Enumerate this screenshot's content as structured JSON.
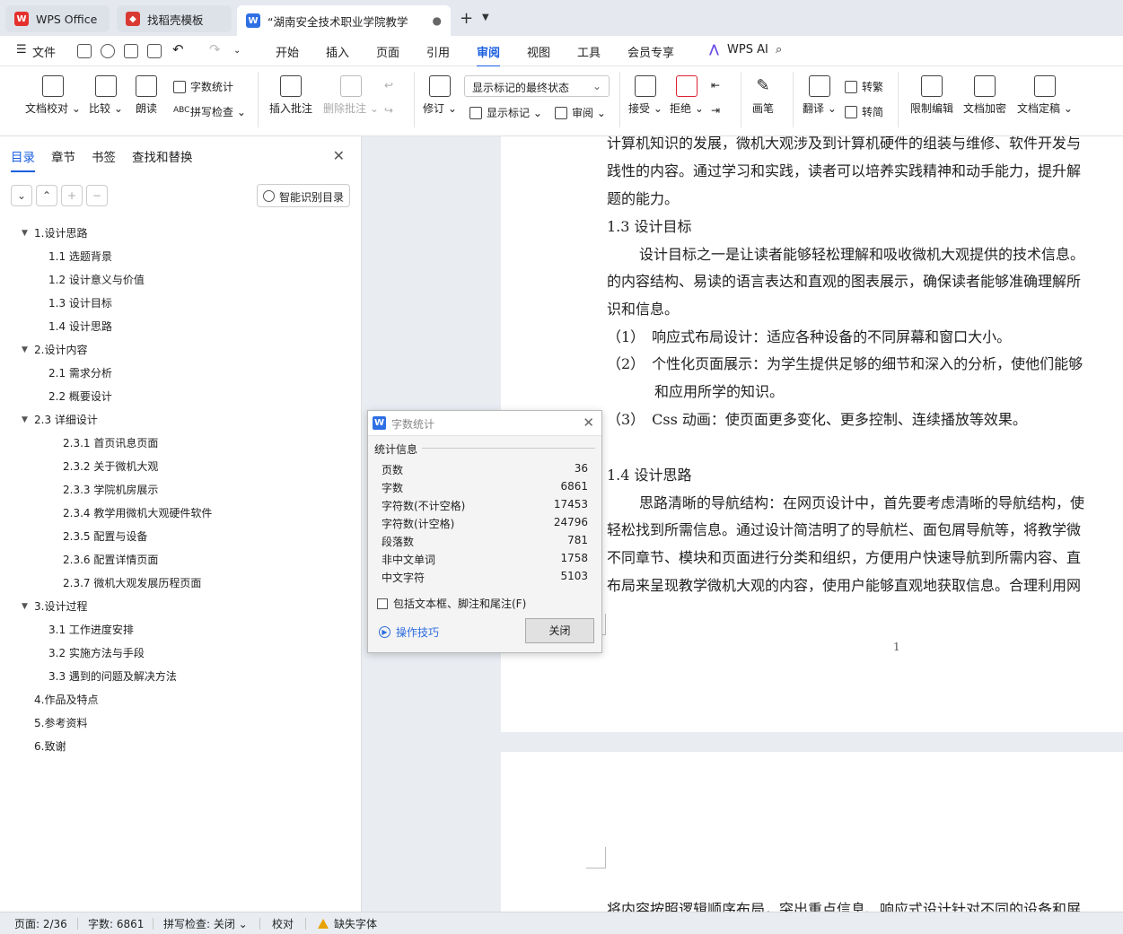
{
  "tabs": [
    {
      "label": "WPS Office",
      "color": "#e5312d"
    },
    {
      "label": "找稻壳模板",
      "color": "#d83a32"
    },
    {
      "label": "“湖南安全技术职业学院教学",
      "color": "#2f6fe4"
    }
  ],
  "menubar": {
    "file": "文件",
    "items": [
      "开始",
      "插入",
      "页面",
      "引用",
      "审阅",
      "视图",
      "工具",
      "会员专享"
    ],
    "active": "审阅",
    "wps_ai": "WPS AI"
  },
  "ribbon": {
    "doc_proofread": "文档校对",
    "compare": "比较",
    "read_aloud": "朗读",
    "word_count": "字数统计",
    "spell_check": "拼写检查",
    "insert_comment": "插入批注",
    "delete_comment": "删除批注",
    "revise": "修订",
    "display_select": "显示标记的最终状态",
    "show_markup": "显示标记",
    "review": "审阅",
    "accept": "接受",
    "reject": "拒绝",
    "pen": "画笔",
    "translate": "翻译",
    "to_traditional": "转繁",
    "to_simplified": "转简",
    "restrict_edit": "限制编辑",
    "encrypt": "文档加密",
    "finalize": "文档定稿"
  },
  "nav": {
    "tabs": [
      "目录",
      "章节",
      "书签",
      "查找和替换"
    ],
    "smart_toc": "智能识别目录",
    "toc": [
      {
        "label": "1.设计思路",
        "level": 1,
        "expanded": true
      },
      {
        "label": "1.1 选题背景",
        "level": 2
      },
      {
        "label": "1.2 设计意义与价值",
        "level": 2
      },
      {
        "label": "1.3 设计目标",
        "level": 2
      },
      {
        "label": "1.4 设计思路",
        "level": 2
      },
      {
        "label": "2.设计内容",
        "level": 1,
        "expanded": true
      },
      {
        "label": "2.1 需求分析",
        "level": 2
      },
      {
        "label": "2.2 概要设计",
        "level": 2
      },
      {
        "label": "2.3 详细设计",
        "level": 1,
        "expanded": true
      },
      {
        "label": "2.3.1 首页讯息页面",
        "level": 3
      },
      {
        "label": "2.3.2 关于微机大观",
        "level": 3
      },
      {
        "label": "2.3.3 学院机房展示",
        "level": 3
      },
      {
        "label": "2.3.4 教学用微机大观硬件软件",
        "level": 3
      },
      {
        "label": "2.3.5 配置与设备",
        "level": 3
      },
      {
        "label": "2.3.6 配置详情页面",
        "level": 3
      },
      {
        "label": "2.3.7 微机大观发展历程页面",
        "level": 3
      },
      {
        "label": "3.设计过程",
        "level": 1,
        "expanded": true
      },
      {
        "label": "3.1 工作进度安排",
        "level": 2
      },
      {
        "label": "3.2 实施方法与手段",
        "level": 2
      },
      {
        "label": "3.3 遇到的问题及解决方法",
        "level": 2
      },
      {
        "label": "4.作品及特点",
        "level": 1
      },
      {
        "label": "5.参考资料",
        "level": 1
      },
      {
        "label": "6.致谢",
        "level": 1
      }
    ]
  },
  "document": {
    "lines": [
      "计算机知识的发展，微机大观涉及到计算机硬件的组装与维修、软件开发与",
      "践性的内容。通过学习和实践，读者可以培养实践精神和动手能力，提升解",
      "题的能力。",
      "1.3 设计目标",
      "设计目标之一是让读者能够轻松理解和吸收微机大观提供的技术信息。",
      "的内容结构、易读的语言表达和直观的图表展示，确保读者能够准确理解所",
      "识和信息。",
      "（1）　响应式布局设计：适应各种设备的不同屏幕和窗口大小。",
      "（2）　个性化页面展示：为学生提供足够的细节和深入的分析，使他们能够",
      "和应用所学的知识。",
      "（3）　Css 动画：使页面更多变化、更多控制、连续播放等效果。",
      "1.4 设计思路",
      "思路清晰的导航结构：在网页设计中，首先要考虑清晰的导航结构，使",
      "轻松找到所需信息。通过设计简洁明了的导航栏、面包屑导航等，将教学微",
      "不同章节、模块和页面进行分类和组织，方便用户快速导航到所需内容、直",
      "布局来呈现教学微机大观的内容，使用户能够直观地获取信息。合理利用网"
    ],
    "page_number": "1",
    "page2_line": "将内容按照逻辑顺序布局，突出重点信息、响应式设计针对不同的设备和屏"
  },
  "dialog": {
    "title": "字数统计",
    "group": "统计信息",
    "stats": [
      {
        "label": "页数",
        "value": "36"
      },
      {
        "label": "字数",
        "value": "6861"
      },
      {
        "label": "字符数(不计空格)",
        "value": "17453"
      },
      {
        "label": "字符数(计空格)",
        "value": "24796"
      },
      {
        "label": "段落数",
        "value": "781"
      },
      {
        "label": "非中文单词",
        "value": "1758"
      },
      {
        "label": "中文字符",
        "value": "5103"
      }
    ],
    "checkbox_label": "包括文本框、脚注和尾注(F)",
    "tips": "操作技巧",
    "close_button": "关闭"
  },
  "statusbar": {
    "page": "页面: 2/36",
    "words": "字数: 6861",
    "spell": "拼写检查: 关闭",
    "proof": "校对",
    "missing_font": "缺失字体"
  }
}
